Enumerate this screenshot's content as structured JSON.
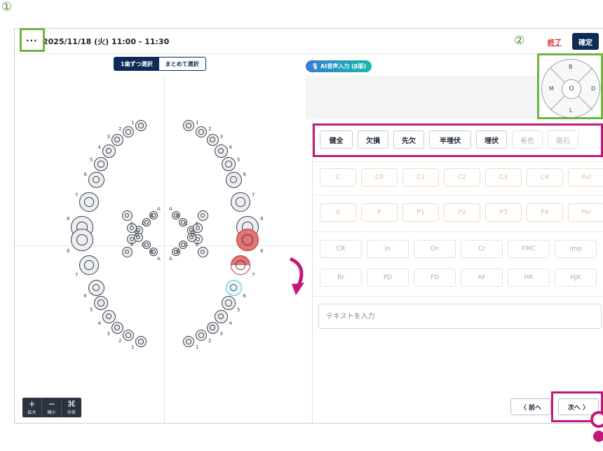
{
  "header": {
    "menu_dots": "···",
    "date": "2025/11/18 (火) 11:00 - 11:30",
    "end_label": "終了",
    "confirm_label": "確定"
  },
  "selection": {
    "single": "1歯ずつ選択",
    "batch": "まとめて選択"
  },
  "zoom": [
    {
      "glyph": "+",
      "label": "拡大"
    },
    {
      "glyph": "−",
      "label": "縮小"
    },
    {
      "glyph": "⌘",
      "label": "中央"
    }
  ],
  "ai": {
    "label": "AI音声入力 (β版)"
  },
  "surface": {
    "b": "B",
    "m": "M",
    "o": "O",
    "d": "D",
    "l": "L"
  },
  "status_buttons": [
    {
      "label": "健全",
      "enabled": true
    },
    {
      "label": "欠損",
      "enabled": true
    },
    {
      "label": "先欠",
      "enabled": true
    },
    {
      "label": "半埋伏",
      "enabled": true
    },
    {
      "label": "埋伏",
      "enabled": true
    },
    {
      "label": "着色",
      "enabled": false
    },
    {
      "label": "歯石",
      "enabled": false
    }
  ],
  "caries": [
    "C",
    "C0",
    "C1",
    "C2",
    "C3",
    "C4",
    "Pul"
  ],
  "perio": [
    "G",
    "P",
    "P1",
    "P2",
    "P3",
    "P4",
    "Per"
  ],
  "prosth_row1": [
    "CR",
    "In",
    "On",
    "Cr",
    "FMC",
    "Imp"
  ],
  "prosth_row2": [
    "Br",
    "PD",
    "FD",
    "AF",
    "HR",
    "HJK"
  ],
  "text_input": {
    "placeholder": "テキストを入力"
  },
  "nav": {
    "prev": "〈 前へ",
    "next": "次へ 〉"
  },
  "annotations": {
    "one": "①",
    "two": "②"
  },
  "tooth_labels": {
    "ur": [
      "1",
      "2",
      "3",
      "4",
      "5",
      "6",
      "7",
      "8"
    ],
    "ul": [
      "1",
      "2",
      "3",
      "4",
      "5",
      "6",
      "7",
      "8"
    ],
    "pri": [
      "A",
      "B",
      "C",
      "D",
      "E"
    ]
  },
  "colors": {
    "navy": "#0d2b55",
    "highlight_green": "#6db33f",
    "highlight_magenta": "#c2187a",
    "selected_red": "#d9534f",
    "selected_cyan": "#4fc3e8"
  }
}
